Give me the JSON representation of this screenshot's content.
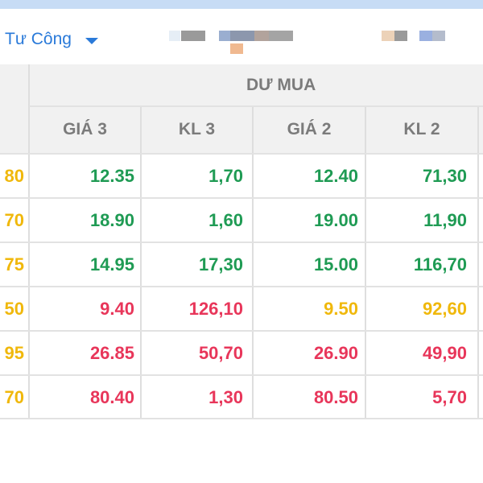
{
  "tabs": {
    "active_label": "Tư Công"
  },
  "table": {
    "group_header": "DƯ MUA",
    "columns": [
      "GIÁ 3",
      "KL 3",
      "GIÁ 2",
      "KL 2"
    ],
    "rows": [
      {
        "prev": "80",
        "prev_color": "yellow",
        "cells": [
          {
            "v": "12.35",
            "c": "green"
          },
          {
            "v": "1,70",
            "c": "green"
          },
          {
            "v": "12.40",
            "c": "green"
          },
          {
            "v": "71,30",
            "c": "green"
          }
        ]
      },
      {
        "prev": "70",
        "prev_color": "yellow",
        "cells": [
          {
            "v": "18.90",
            "c": "green"
          },
          {
            "v": "1,60",
            "c": "green"
          },
          {
            "v": "19.00",
            "c": "green"
          },
          {
            "v": "11,90",
            "c": "green"
          }
        ]
      },
      {
        "prev": "75",
        "prev_color": "yellow",
        "cells": [
          {
            "v": "14.95",
            "c": "green"
          },
          {
            "v": "17,30",
            "c": "green"
          },
          {
            "v": "15.00",
            "c": "green"
          },
          {
            "v": "116,70",
            "c": "green"
          }
        ]
      },
      {
        "prev": "50",
        "prev_color": "yellow",
        "cells": [
          {
            "v": "9.40",
            "c": "red"
          },
          {
            "v": "126,10",
            "c": "red"
          },
          {
            "v": "9.50",
            "c": "yellow"
          },
          {
            "v": "92,60",
            "c": "yellow"
          }
        ]
      },
      {
        "prev": "95",
        "prev_color": "yellow",
        "cells": [
          {
            "v": "26.85",
            "c": "red"
          },
          {
            "v": "50,70",
            "c": "red"
          },
          {
            "v": "26.90",
            "c": "red"
          },
          {
            "v": "49,90",
            "c": "red"
          }
        ]
      },
      {
        "prev": "70",
        "prev_color": "yellow",
        "cells": [
          {
            "v": "80.40",
            "c": "red"
          },
          {
            "v": "1,30",
            "c": "red"
          },
          {
            "v": "80.50",
            "c": "red"
          },
          {
            "v": "5,70",
            "c": "red"
          }
        ]
      }
    ]
  },
  "colors": {
    "accent": "#2a7ad9",
    "green": "#1f9b54",
    "red": "#e8365a",
    "yellow": "#f0b80c",
    "header_bg": "#f1f1f1"
  }
}
